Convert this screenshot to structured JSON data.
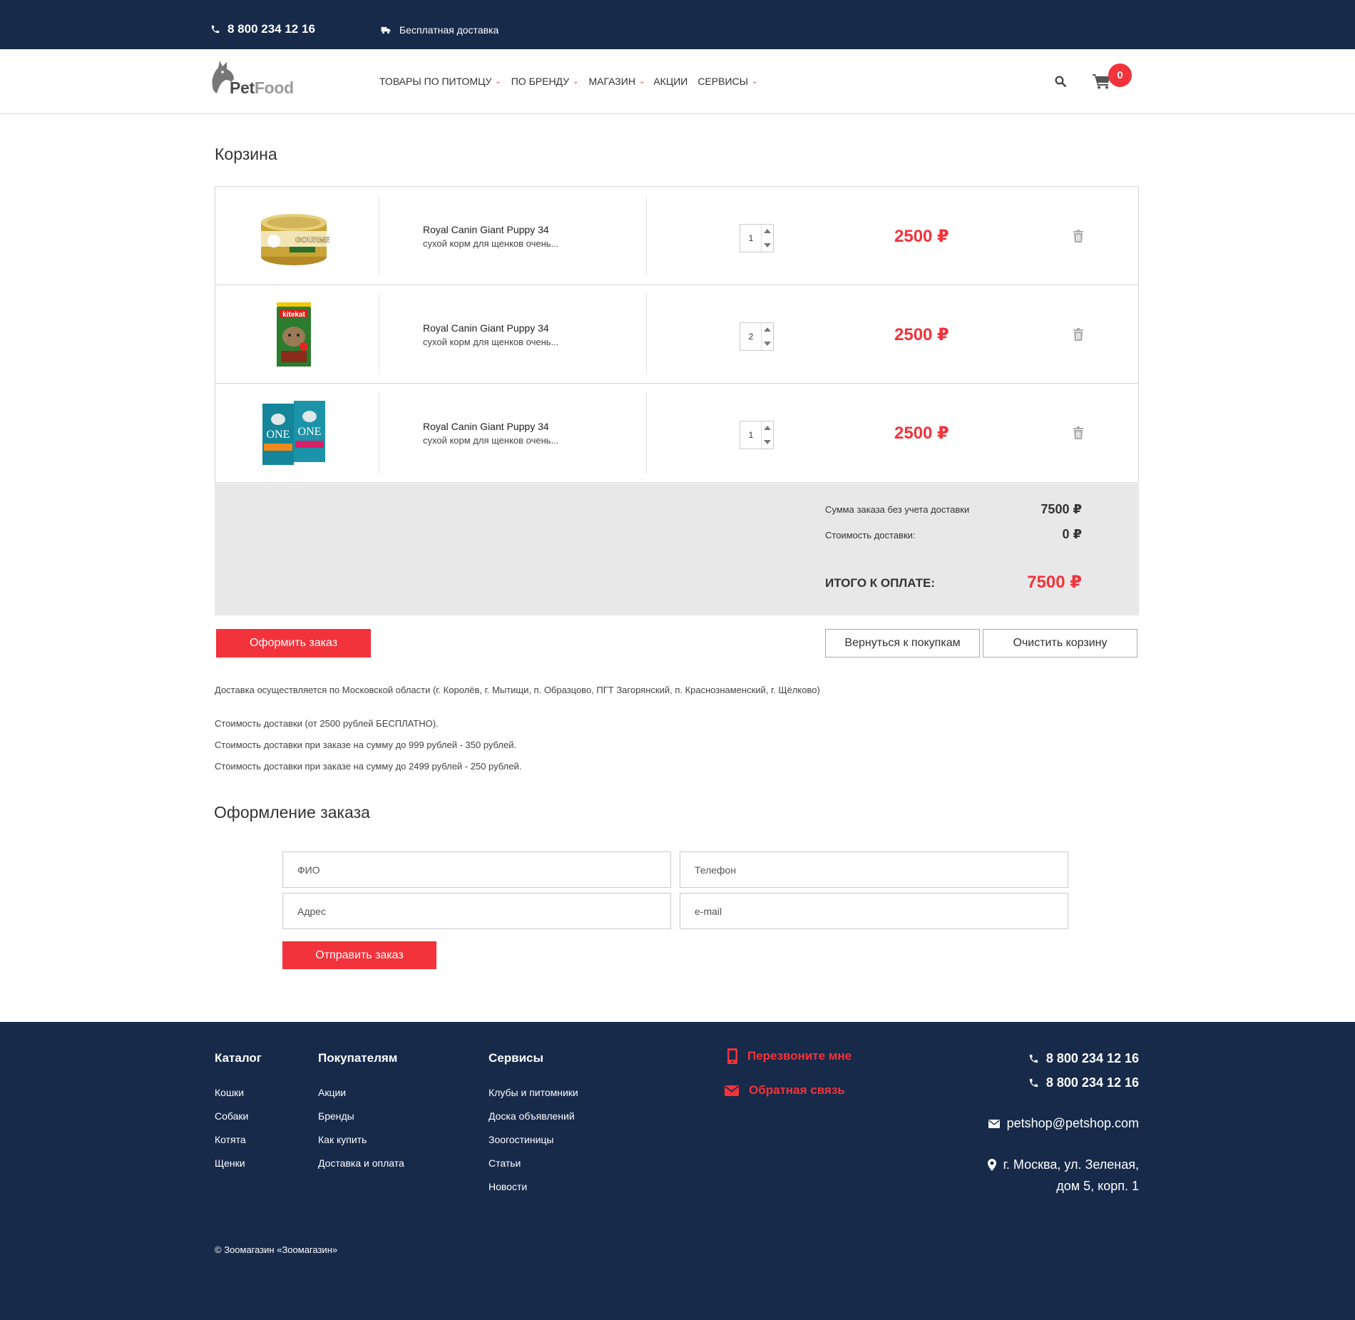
{
  "topbar": {
    "phone": "8 800 234 12 16",
    "delivery": "Бесплатная доставка"
  },
  "header": {
    "logo_part1": "Pet",
    "logo_part2": "Food",
    "nav": [
      {
        "label": "ТОВАРЫ ПО ПИТОМЦУ",
        "has_dropdown": true
      },
      {
        "label": "ПО БРЕНДУ",
        "has_dropdown": true
      },
      {
        "label": "МАГАЗИН",
        "has_dropdown": true
      },
      {
        "label": "АКЦИИ",
        "has_dropdown": false
      },
      {
        "label": "СЕРВИСЫ",
        "has_dropdown": true
      }
    ],
    "cart_count": "0"
  },
  "cart": {
    "title": "Корзина",
    "items": [
      {
        "name": "Royal Canin Giant Puppy 34",
        "desc": "сухой корм для щенков очень...",
        "qty": "1",
        "price": "2500 ₽",
        "image": "gourmet-can"
      },
      {
        "name": "Royal Canin Giant Puppy 34",
        "desc": "сухой корм для щенков очень...",
        "qty": "2",
        "price": "2500 ₽",
        "image": "kitekat-bag"
      },
      {
        "name": "Royal Canin Giant Puppy 34",
        "desc": "сухой корм для щенков очень...",
        "qty": "1",
        "price": "2500 ₽",
        "image": "purina-one-bags"
      }
    ],
    "summary": {
      "subtotal_label": "Сумма заказа без учета доставки",
      "subtotal_value": "7500 ₽",
      "delivery_label": "Стоимость доставки:",
      "delivery_value": "0 ₽",
      "total_label": "ИТОГО К ОПЛАТЕ:",
      "total_value": "7500 ₽"
    },
    "buttons": {
      "checkout": "Оформить заказ",
      "back": "Вернуться к покупкам",
      "clear": "Очистить корзину"
    }
  },
  "info": [
    "Доставка осуществляется по Московской области (г. Королёв, г. Мытищи, п. Образцово, ПГТ Загорянский, п. Краснознаменский, г. Щёлково)",
    "Стоимость доставки (от 2500 рублей БЕСПЛАТНО).",
    "Стоимость доставки при заказе на сумму до 999 рублей - 350 рублей.",
    "Стоимость доставки при заказе на сумму до 2499 рублей - 250 рублей."
  ],
  "order_form": {
    "title": "Оформление заказа",
    "fio_placeholder": "ФИО",
    "phone_placeholder": "Телефон",
    "address_placeholder": "Адрес",
    "email_placeholder": "e-mail",
    "submit": "Отправить заказ"
  },
  "footer": {
    "columns": [
      {
        "title": "Каталог",
        "links": [
          "Кошки",
          "Собаки",
          "Котята",
          "Щенки"
        ]
      },
      {
        "title": "Покупателям",
        "links": [
          "Акции",
          "Бренды",
          "Как купить",
          "Доставка и оплата"
        ]
      },
      {
        "title": "Сервисы",
        "links": [
          "Клубы и питомники",
          "Доска объявлений",
          "Зоогостиницы",
          "Статьи",
          "Новости"
        ]
      }
    ],
    "callback": "Перезвоните мне",
    "feedback": "Обратная связь",
    "phone1": "8 800 234 12 16",
    "phone2": "8 800 234 12 16",
    "email": "petshop@petshop.com",
    "address_line1": "г. Москва, ул. Зеленая,",
    "address_line2": "дом 5, корп. 1",
    "copyright": "© Зоомагазин «Зоомагазин»"
  },
  "colors": {
    "navy": "#172a4a",
    "accent_red": "#f2333b",
    "summary_bg": "#e8e8e8"
  }
}
